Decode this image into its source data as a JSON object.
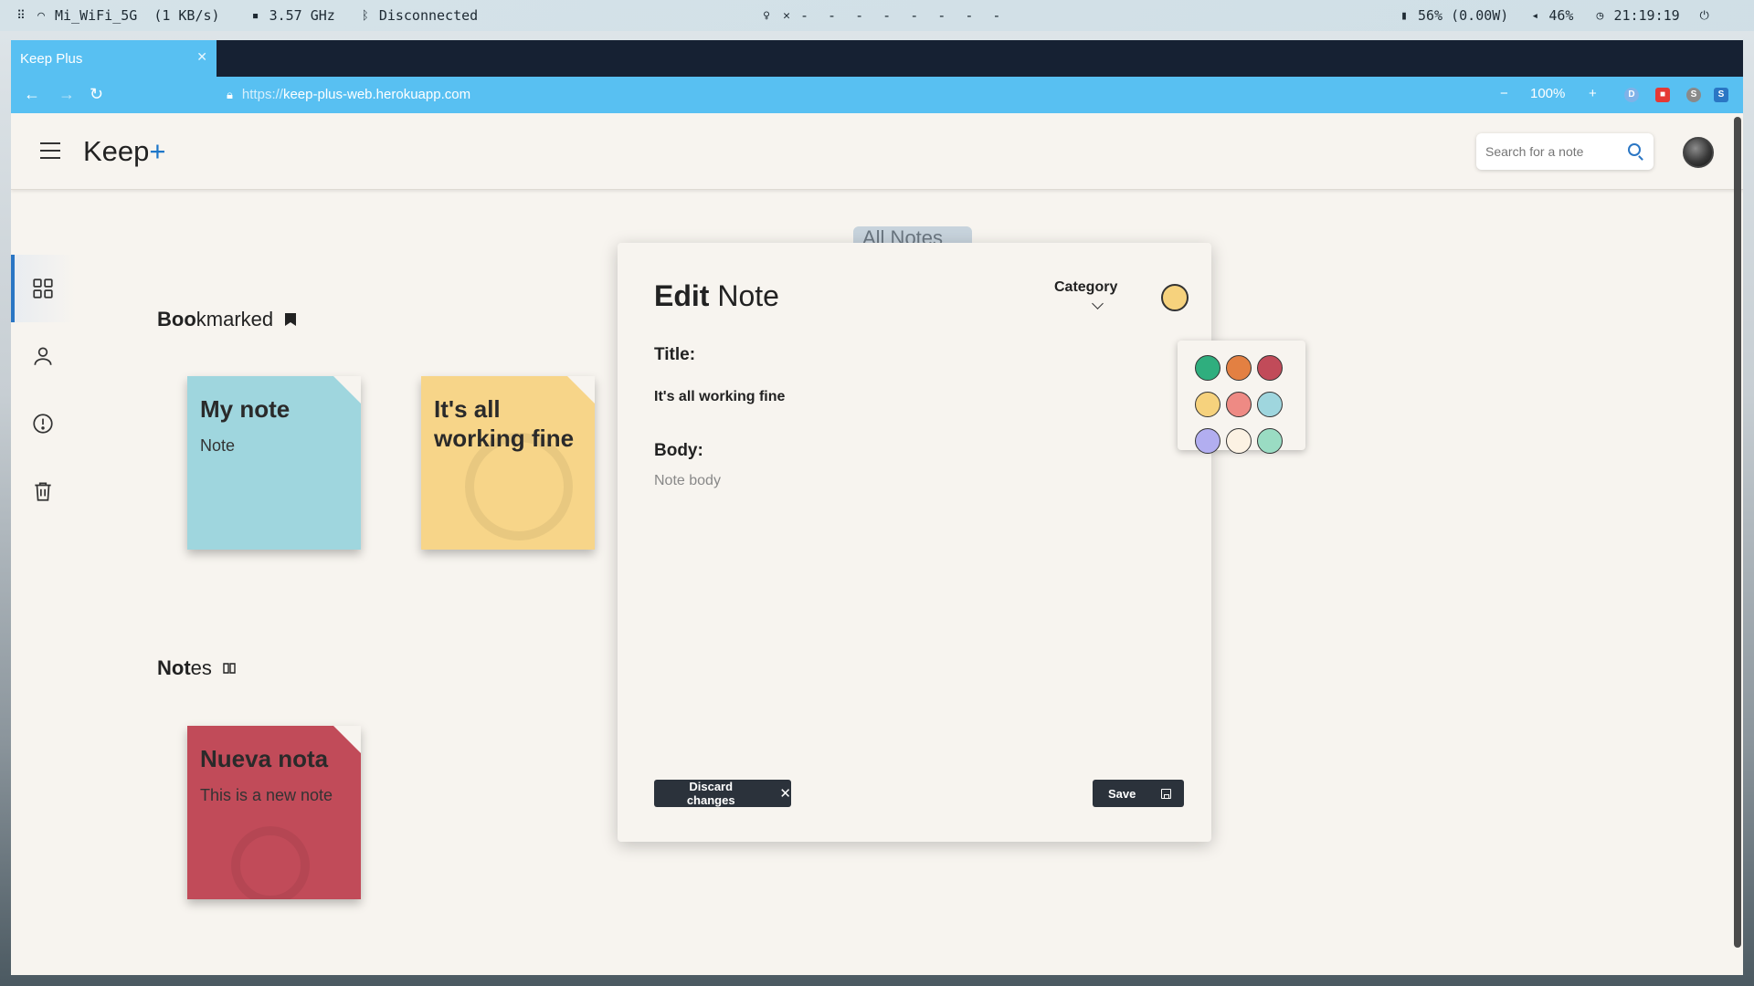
{
  "system_bar": {
    "wifi": "Mi_WiFi_5G",
    "rate": "(1 KB/s)",
    "cpu": "3.57 GHz",
    "bluetooth": "Disconnected",
    "workspaces": "- - - - - - - -",
    "battery": "56% (0.00W)",
    "volume": "46%",
    "clock": "21:19:19"
  },
  "browser": {
    "tab_title": "Keep Plus",
    "url_scheme": "https://",
    "url_host": "keep-plus-web.herokuapp.com",
    "zoom": "100%"
  },
  "app": {
    "brand": "Keep",
    "brand_plus": "+",
    "search_placeholder": "Search for a note",
    "sections": {
      "bookmarked_bold": "Boo",
      "bookmarked_rest": "kmarked",
      "notes_bold": "Not",
      "notes_rest": "es"
    },
    "ghost_tab": "All Notes",
    "bookmarked_notes": [
      {
        "title": "My note",
        "body": "Note",
        "color": "#9fd6de"
      },
      {
        "title": "It's all working fine",
        "body": "",
        "color": "#f7d589"
      }
    ],
    "notes": [
      {
        "title": "Nueva nota",
        "body": "This is a new note",
        "color": "#c14b59"
      }
    ]
  },
  "modal": {
    "title_bold": "Edit",
    "title_rest": "Note",
    "category_label": "Category",
    "selected_color": "#f6d27d",
    "title_label": "Title:",
    "title_value": "It's all working fine",
    "body_label": "Body:",
    "body_placeholder": "Note body",
    "discard_label": "Discard changes",
    "save_label": "Save"
  },
  "color_picker": {
    "swatches": [
      "#2fae7e",
      "#e38042",
      "#c14b59",
      "#f6d27d",
      "#ee8a84",
      "#9fd6de",
      "#b2aef0",
      "#fcf2e3",
      "#9adcc3"
    ]
  }
}
